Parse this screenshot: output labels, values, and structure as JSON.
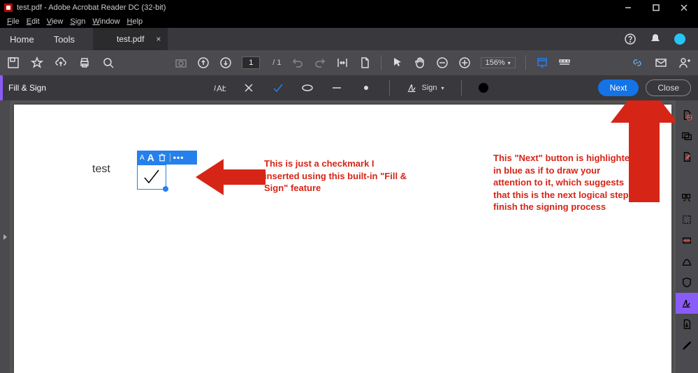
{
  "title": "test.pdf - Adobe Acrobat Reader DC (32-bit)",
  "menu": {
    "file": "File",
    "edit": "Edit",
    "view": "View",
    "sign": "Sign",
    "window": "Window",
    "help": "Help"
  },
  "tabs": {
    "home": "Home",
    "tools": "Tools",
    "doc": "test.pdf"
  },
  "toolbar": {
    "page_current": "1",
    "page_total": "/  1",
    "zoom": "156%"
  },
  "fillsign": {
    "label": "Fill & Sign",
    "sign_label": "Sign",
    "next": "Next",
    "close": "Close"
  },
  "page": {
    "text_test": "test",
    "annot_left": "This is just a checkmark I inserted using this built-in \"Fill & Sign\" feature",
    "annot_right": "This \"Next\" button is highlighted in blue as if to draw your attention to it, which suggests that this is the next logical step to finish  the signing process"
  },
  "checkmark_toolbar": {
    "small_a": "A",
    "big_a": "A"
  },
  "colors": {
    "accent": "#2680eb",
    "annot": "#d62516",
    "signpurple": "#8a5cf6"
  }
}
